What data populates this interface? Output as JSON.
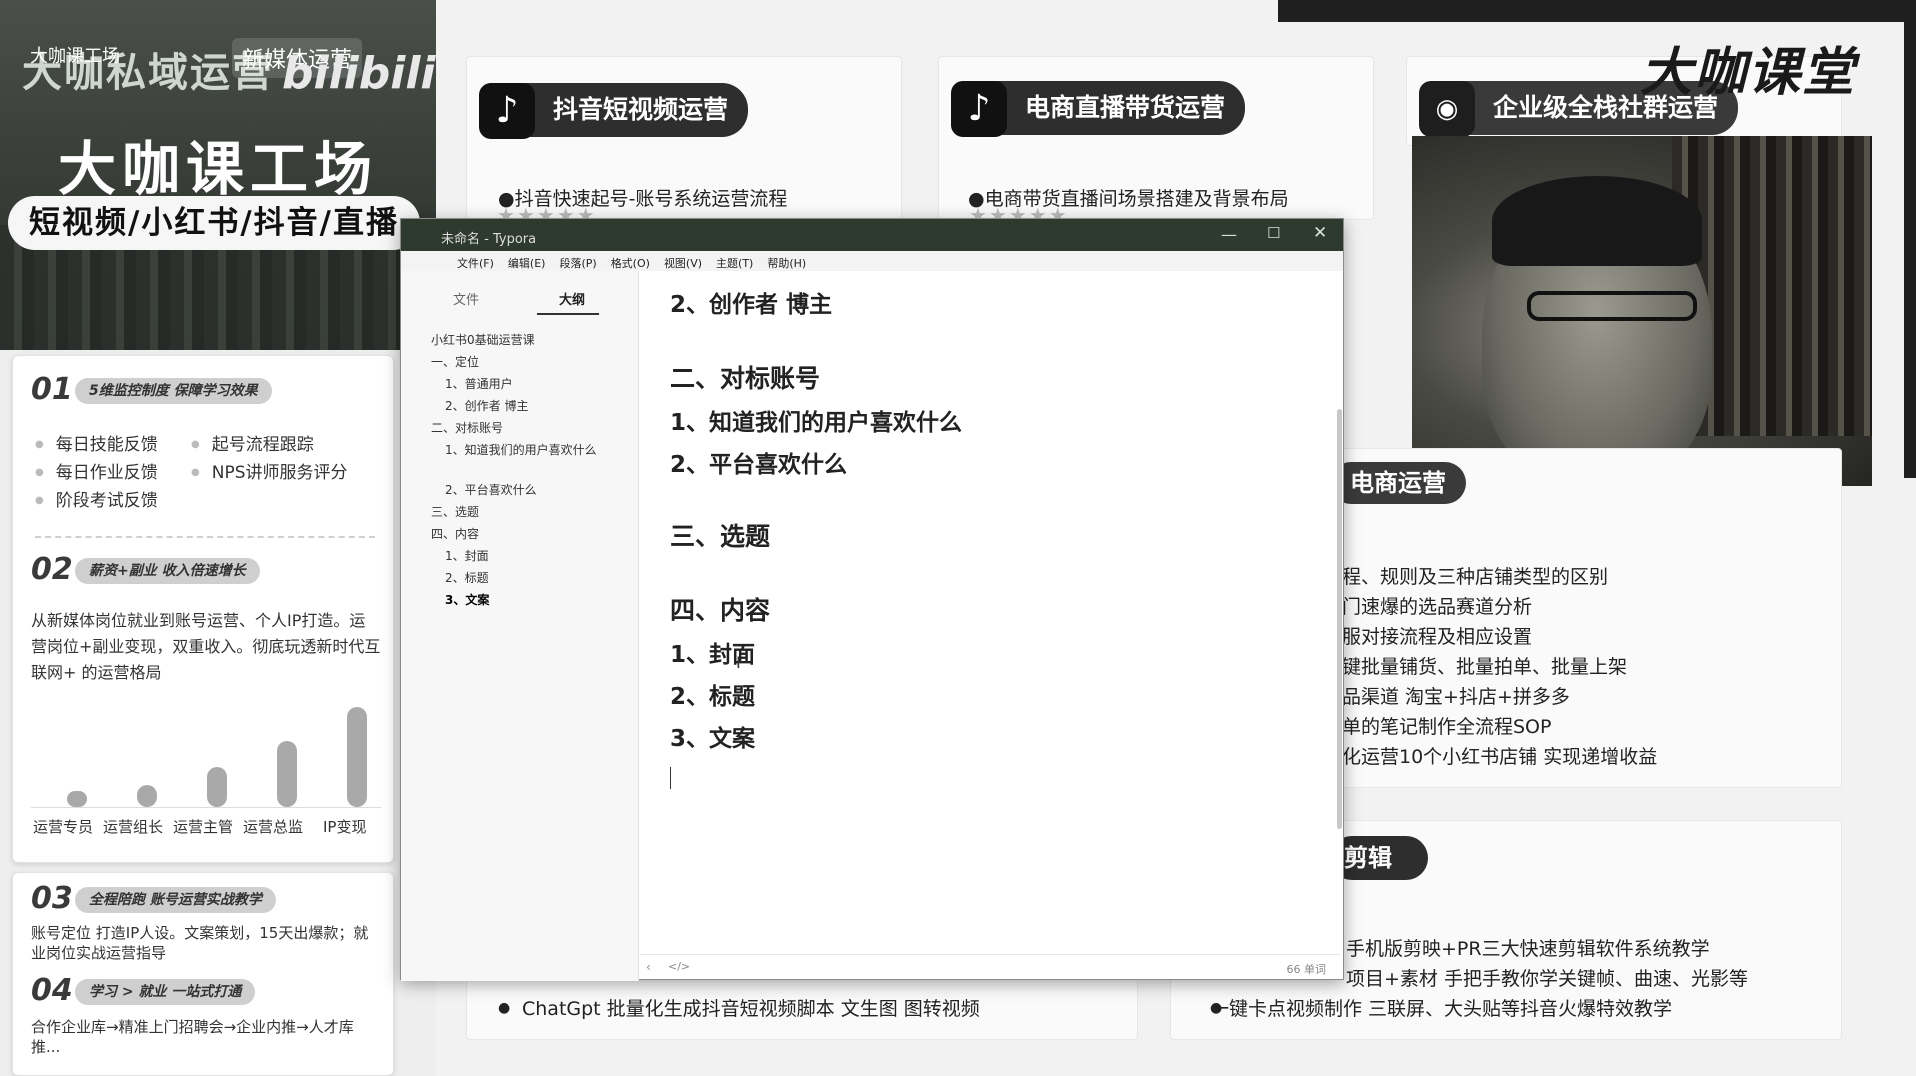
{
  "left_banner": {
    "brand": "大咖私域运营",
    "sub_brand": "大咖课工场",
    "new_media": "新媒体运营",
    "bili": "bilibili",
    "school": "大咖课工场",
    "tags": "短视频/小红书/抖音/直播"
  },
  "sections": [
    {
      "num": "01",
      "title": "5维监控制度 保障学习效果",
      "bullets": [
        "每日技能反馈",
        "起号流程跟踪",
        "每日作业反馈",
        "NPS讲师服务评分",
        "阶段考试反馈"
      ]
    },
    {
      "num": "02",
      "title": "薪资+副业 收入倍速增长",
      "text": "从新媒体岗位就业到账号运营、个人IP打造。运营岗位+副业变现，双重收入。彻底玩透新时代互联网+ 的运营格局",
      "chart_categories": [
        "运营专员",
        "运营组长",
        "运营主管",
        "运营总监",
        "IP变现"
      ],
      "chart_values": [
        1,
        2,
        3,
        4,
        6
      ]
    },
    {
      "num": "03",
      "title": "全程陪跑 账号运营实战教学",
      "text": "账号定位 打造IP人设。文案策划，15天出爆款；就业岗位实战运营指导"
    },
    {
      "num": "04",
      "title": "学习 > 就业 一站式打通",
      "text": "合作企业库→精准上门招聘会→企业内推→人才库推..."
    }
  ],
  "cards": {
    "douyin": {
      "title": "抖音短视频运营",
      "item": "●抖音快速起号-账号系统运营流程"
    },
    "ecom_live": {
      "title": "电商直播带货运营",
      "item": "●电商带货直播间场景搭建及背景布局"
    },
    "wechat": {
      "title": "企业级全栈社群运营"
    }
  },
  "brand_logo": "大咖课堂",
  "right_section": {
    "title": "电商运营",
    "items": [
      "程、规则及三种店铺类型的区别",
      "门速爆的选品赛道分析",
      "服对接流程及相应设置",
      "键批量铺货、批量拍单、批量上架",
      "品渠道 淘宝+抖店+拼多多",
      "单的笔记制作全流程SOP",
      "化运营10个小红书店铺 实现递增收益"
    ]
  },
  "edit_section": {
    "title": "剪辑",
    "items": [
      "手机版剪映+PR三大快速剪辑软件系统教学",
      "项目+素材 手把手教你学关键帧、曲速、光影等",
      "一键卡点视频制作 三联屏、大头贴等抖音火爆特效教学"
    ]
  },
  "bottom_left_items": [
    "ChatGpt 批量化生成抖音短视频脚本 文生图 图转视频"
  ],
  "typora": {
    "title": "未命名 - Typora",
    "menu": [
      "文件(F)",
      "编辑(E)",
      "段落(P)",
      "格式(O)",
      "视图(V)",
      "主题(T)",
      "帮助(H)"
    ],
    "tab_file": "文件",
    "tab_outline": "大纲",
    "outline": [
      "小红书0基础运营课",
      "一、定位",
      "1、普通用户",
      "2、创作者 博主",
      "二、对标账号",
      "1、知道我们的用户喜欢什么",
      "2、平台喜欢什么",
      "三、选题",
      "四、内容",
      "1、封面",
      "2、标题",
      "3、文案"
    ],
    "content": {
      "c1": "2、创作者 博主",
      "h2": "二、对标账号",
      "c2": "1、知道我们的用户喜欢什么",
      "c3": "2、平台喜欢什么",
      "h3": "三、选题",
      "h4": "四、内容",
      "c4": "1、封面",
      "c5": "2、标题",
      "c6": "3、文案"
    },
    "word_count": "66 单词"
  }
}
